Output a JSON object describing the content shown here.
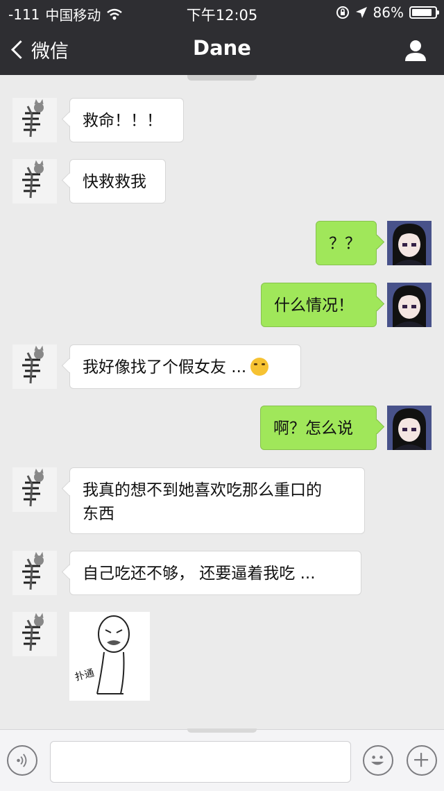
{
  "status_bar": {
    "signal": "-111",
    "carrier": "中国移动",
    "time": "下午12:05",
    "battery": "86%",
    "battery_level": 0.86
  },
  "nav": {
    "back_label": "微信",
    "title": "Dane",
    "profile_icon": "person-icon"
  },
  "messages": [
    {
      "side": "in",
      "text": "救命！！！"
    },
    {
      "side": "in",
      "text": "快救救我"
    },
    {
      "side": "out",
      "text": "？？"
    },
    {
      "side": "out",
      "text": "什么情况！"
    },
    {
      "side": "in",
      "text": "我好像找了个假女友 ...",
      "emoji": "laughing-crying-emoji"
    },
    {
      "side": "out",
      "text": "啊？怎么说"
    },
    {
      "side": "in",
      "text_line1": "我真的想不到她喜欢吃那么重口的",
      "text_line2": "东西"
    },
    {
      "side": "in",
      "text": "自己吃还不够，  还要逼着我吃 ..."
    },
    {
      "side": "in",
      "sticker_text": "扑通"
    }
  ],
  "input_bar": {
    "voice_icon": "voice-icon",
    "emoji_icon": "emoji-face-icon",
    "plus_icon": "plus-icon",
    "input_value": ""
  },
  "colors": {
    "topbar": "#2e2e32",
    "chat_bg": "#ebebeb",
    "out_bubble": "#a0e75a",
    "in_bubble": "#ffffff"
  }
}
